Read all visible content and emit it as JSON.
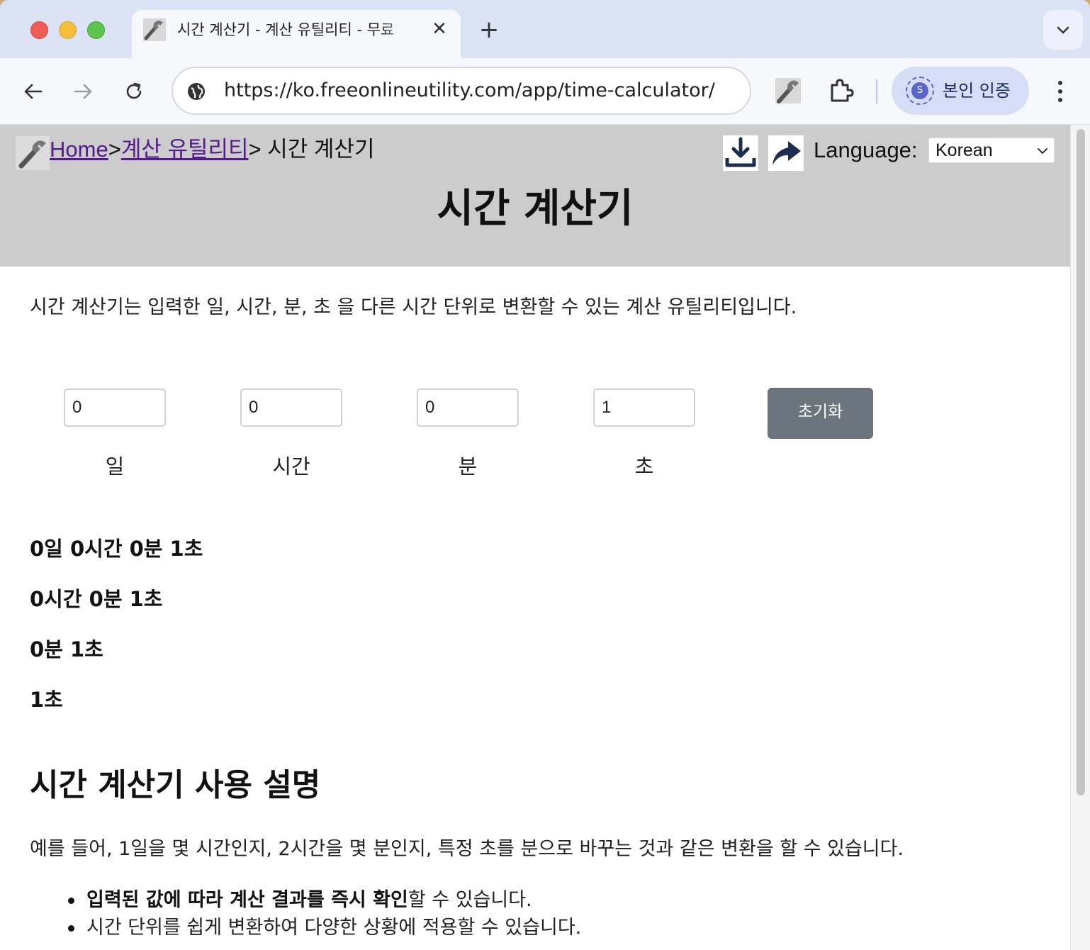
{
  "browser": {
    "tab_title": "시간 계산기 - 계산 유틸리티 - 무료",
    "tab_close": "✕",
    "new_tab": "+",
    "tab_menu": "⌄",
    "url": "https://ko.freeonlineutility.com/app/time-calculator/",
    "profile_initial": "S",
    "profile_label": "본인 인증",
    "icons": {
      "back": "back-arrow-icon",
      "forward": "forward-arrow-icon",
      "reload": "reload-icon",
      "site_info": "site-info-icon",
      "extension": "wrench-extension-icon",
      "extensions_menu": "puzzle-icon",
      "menu": "kebab-menu-icon"
    }
  },
  "header": {
    "breadcrumb": {
      "home": "Home",
      "sep1": ">",
      "category": "계산 유틸리티",
      "sep2": ">",
      "current": " 시간 계산기"
    },
    "language_label": "Language:",
    "language_value": "Korean",
    "title": "시간 계산기",
    "background": "#cccccc"
  },
  "main": {
    "intro": "시간 계산기는 입력한 일, 시간, 분, 초 을 다른 시간 단위로 변환할 수 있는 계산 유틸리티입니다.",
    "inputs": {
      "day": {
        "value": "0",
        "label": "일"
      },
      "hour": {
        "value": "0",
        "label": "시간"
      },
      "minute": {
        "value": "0",
        "label": "분"
      },
      "second": {
        "value": "1",
        "label": "초"
      }
    },
    "reset_label": "초기화",
    "reset_color": "#6c757d",
    "results": [
      "0일 0시간 0분 1초",
      "0시간 0분 1초",
      "0분 1초",
      "1초"
    ],
    "usage_heading": "시간 계산기 사용 설명",
    "usage_text": "예를 들어, 1일을 몇 시간인지, 2시간을 몇 분인지, 특정 초를 분으로 바꾸는 것과 같은 변환을 할 수 있습니다.",
    "bullets": [
      {
        "bold": "입력된 값에 따라 계산 결과를 즉시 확인",
        "rest": "할 수 있습니다."
      },
      {
        "bold": "",
        "rest": "시간 단위를 쉽게 변환하여 다양한 상황에 적용할 수 있습니다."
      }
    ]
  }
}
